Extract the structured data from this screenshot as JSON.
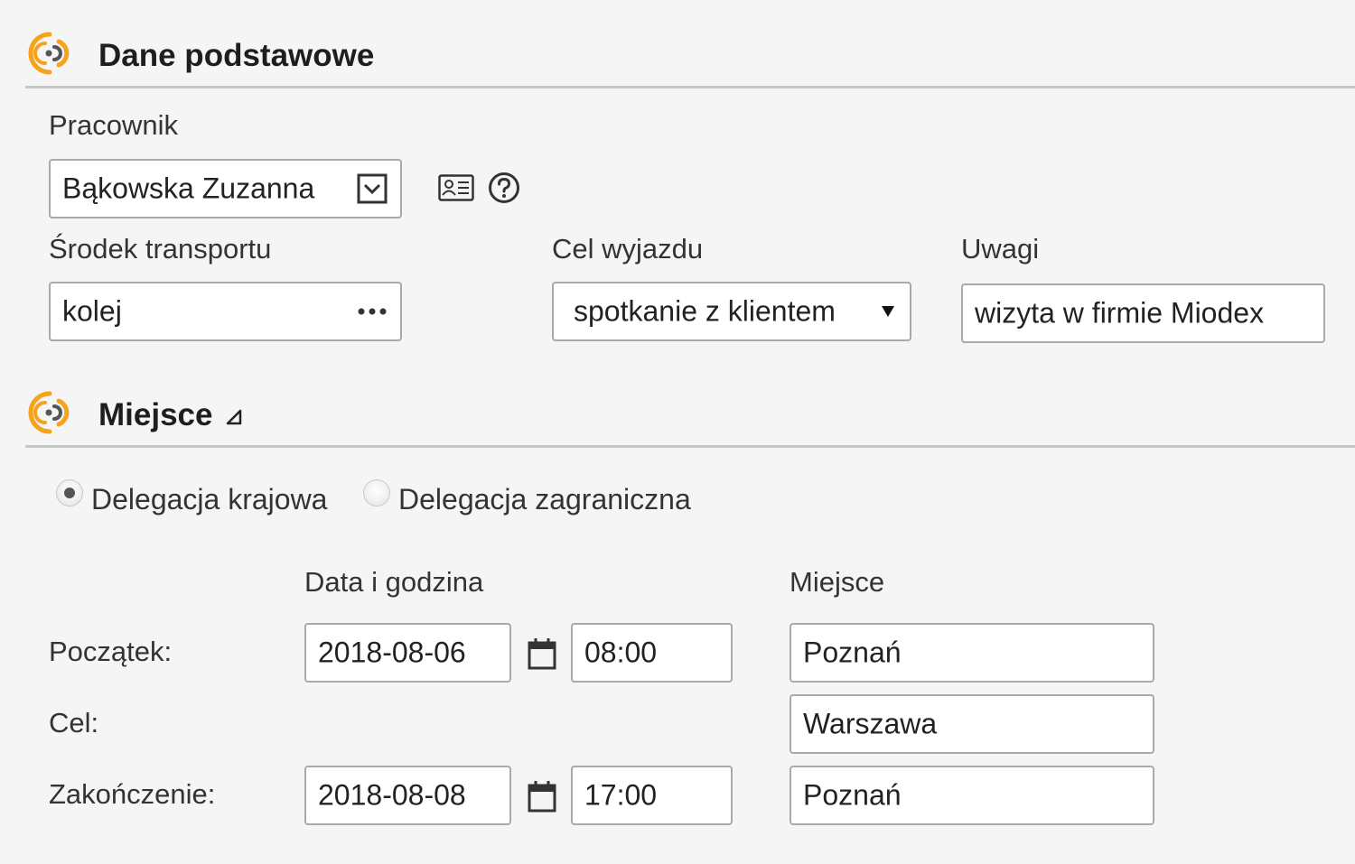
{
  "sections": {
    "basic": {
      "title": "Dane podstawowe"
    },
    "place": {
      "title": "Miejsce"
    }
  },
  "employee": {
    "label": "Pracownik",
    "value": "Bąkowska Zuzanna"
  },
  "transport": {
    "label": "Środek transportu",
    "value": "kolej"
  },
  "purpose": {
    "label": "Cel wyjazdu",
    "value": "spotkanie z klientem"
  },
  "notes": {
    "label": "Uwagi",
    "value": "wizyta w firmie Miodex"
  },
  "delegation": {
    "domestic_label": "Delegacja krajowa",
    "foreign_label": "Delegacja zagraniczna",
    "selected": "domestic"
  },
  "schedule": {
    "col_datetime": "Data i godzina",
    "col_place": "Miejsce",
    "rows": [
      {
        "label": "Początek:",
        "date": "2018-08-06",
        "time": "08:00",
        "place": "Poznań"
      },
      {
        "label": "Cel:",
        "place": "Warszawa"
      },
      {
        "label": "Zakończenie:",
        "date": "2018-08-08",
        "time": "17:00",
        "place": "Poznań"
      }
    ]
  },
  "icons": {
    "section_logo": "radio-waves-icon",
    "employee_dropdown": "dropdown-box-icon",
    "employee_card": "contact-card-icon",
    "help": "help-icon",
    "transport_more": "ellipsis-icon",
    "purpose_caret": "caret-down-icon",
    "calendar": "calendar-icon",
    "collapse": "collapse-triangle-icon"
  },
  "colors": {
    "accent_orange": "#f7a21b",
    "accent_dark": "#555555",
    "border": "#a9a9a9",
    "background": "#f5f5f5"
  }
}
